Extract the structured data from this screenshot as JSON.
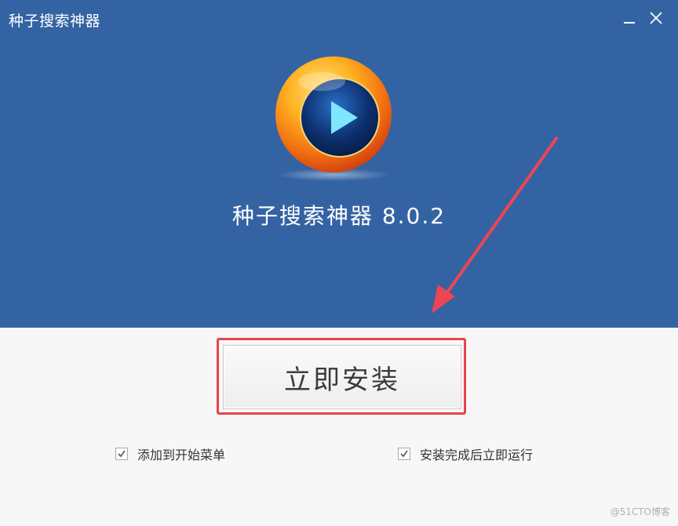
{
  "window": {
    "title": "种子搜索神器"
  },
  "header": {
    "product_name": "种子搜索神器 8.0.2",
    "logo_icon": "play-disc-logo",
    "background_color": "#3463a3"
  },
  "install": {
    "button_label": "立即安装",
    "highlight_color": "#e8434f"
  },
  "options": [
    {
      "label": "添加到开始菜单",
      "checked": true
    },
    {
      "label": "安装完成后立即运行",
      "checked": true
    }
  ],
  "watermark": "@51CTO博客"
}
